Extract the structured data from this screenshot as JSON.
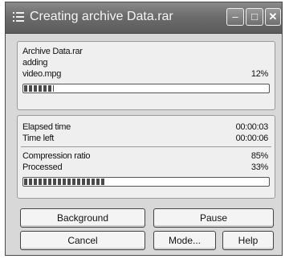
{
  "window": {
    "title": "Creating archive Data.rar",
    "min_glyph": "‒",
    "max_glyph": "□",
    "close_glyph": "✕"
  },
  "current_file": {
    "archive_label": "Archive Data.rar",
    "action": "adding",
    "filename": "video.mpg",
    "percent": "12%",
    "progress": 0.12
  },
  "stats": {
    "elapsed_label": "Elapsed time",
    "elapsed_value": "00:00:03",
    "time_left_label": "Time left",
    "time_left_value": "00:00:06",
    "compression_label": "Compression ratio",
    "compression_value": "85%",
    "processed_label": "Processed",
    "processed_value": "33%",
    "progress": 0.33
  },
  "buttons": {
    "background": "Background",
    "pause": "Pause",
    "cancel": "Cancel",
    "mode": "Mode...",
    "help": "Help"
  },
  "colors": {
    "titlebar": "#6c6c6c",
    "panel": "#efefef",
    "bar_fill": "#4a4a4a"
  },
  "icons": {
    "app": "winrar-list-icon",
    "minimize": "minimize-icon",
    "maximize": "maximize-icon",
    "close": "close-icon"
  }
}
